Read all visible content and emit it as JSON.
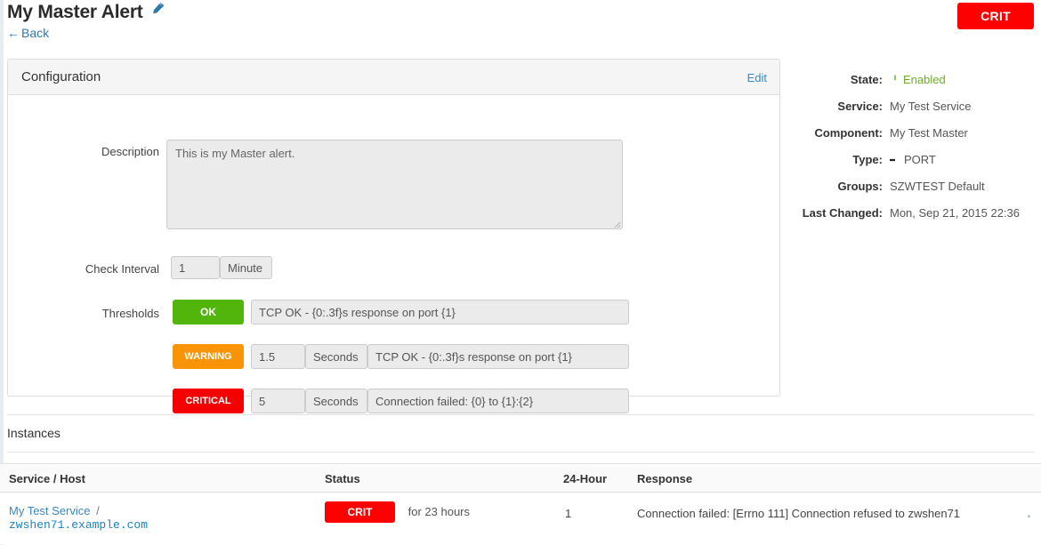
{
  "header": {
    "title": "My Master Alert",
    "edit_icon": "pencil-icon",
    "back_label": "Back",
    "back_arrow": "←",
    "status_badge": "CRIT"
  },
  "configuration": {
    "panel_title": "Configuration",
    "edit_link": "Edit",
    "description_label": "Description",
    "description_value": "This is my Master alert.",
    "check_interval_label": "Check Interval",
    "check_interval_value": "1",
    "check_interval_unit": "Minute",
    "thresholds_label": "Thresholds",
    "thresholds": [
      {
        "level": "OK",
        "value": "",
        "unit": "",
        "message": "TCP OK - {0:.3f}s response on port {1}",
        "color": "#52b50c"
      },
      {
        "level": "WARNING",
        "value": "1.5",
        "unit": "Seconds",
        "message": "TCP OK - {0:.3f}s response on port {1}",
        "color": "#f89406"
      },
      {
        "level": "CRITICAL",
        "value": "5",
        "unit": "Seconds",
        "message": "Connection failed: {0} to {1}:{2}",
        "color": "#f40000"
      }
    ]
  },
  "meta": {
    "rows": [
      {
        "key": "State:",
        "value": "Enabled",
        "icon": "power-icon",
        "accent": "#6ab022"
      },
      {
        "key": "Service:",
        "value": "My Test Service",
        "icon": "",
        "accent": ""
      },
      {
        "key": "Component:",
        "value": "My Test Master",
        "icon": "",
        "accent": ""
      },
      {
        "key": "Type:",
        "value": "PORT",
        "icon": "sign-in-icon",
        "accent": ""
      },
      {
        "key": "Groups:",
        "value": "SZWTEST Default",
        "icon": "",
        "accent": ""
      },
      {
        "key": "Last Changed:",
        "value": "Mon, Sep 21, 2015 22:36",
        "icon": "",
        "accent": ""
      }
    ]
  },
  "instances": {
    "title": "Instances",
    "columns": [
      "Service / Host",
      "Status",
      "24-Hour",
      "Response"
    ],
    "rows": [
      {
        "service": "My Test Service",
        "separator": "/",
        "host": "zwshen71.example.com",
        "status": "CRIT",
        "duration": "for 23 hours",
        "count_24h": "1",
        "response": "Connection failed: [Errno 111] Connection refused to zwshen71",
        "response_overflow": "•"
      }
    ]
  }
}
